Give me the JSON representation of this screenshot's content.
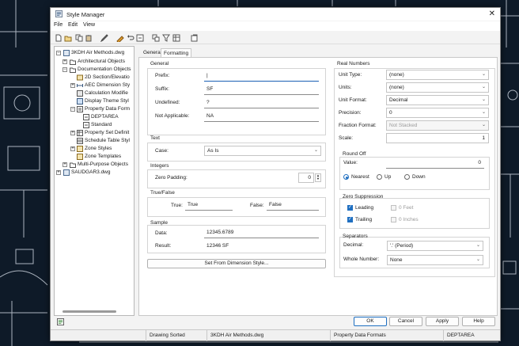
{
  "window": {
    "title": "Style Manager",
    "close_symbol": "✕"
  },
  "menu": [
    "File",
    "Edit",
    "View"
  ],
  "toolbar_icons": [
    "new-icon",
    "open-icon",
    "copy-icon",
    "paste-icon",
    "edit-style-icon",
    "purge-icon",
    "undo-icon",
    "refresh-icon",
    "toggle-view-icon",
    "filter-icon",
    "view-options-icon",
    "help-icon"
  ],
  "tree": {
    "root1": "3KDH Air Methods.dwg",
    "items": [
      "Architectural Objects",
      "Documentation Objects",
      "2D Section/Elevatio",
      "AEC Dimension Sty",
      "Calculation Modifie",
      "Display Theme Styl",
      "Property Data Form",
      "DEPTAREA",
      "Standard",
      "Property Set Definit",
      "Schedule Table Styl",
      "Zone Styles",
      "Zone Templates",
      "Multi-Purpose Objects"
    ],
    "root2": "SAUDGAR3.dwg",
    "tog_plus": "+",
    "tog_minus": "−"
  },
  "tabs": {
    "general": "General",
    "formatting": "Formatting"
  },
  "general": {
    "title": "General",
    "prefix_label": "Prefix:",
    "prefix_value": "|",
    "suffix_label": "Suffix:",
    "suffix_value": "SF",
    "undefined_label": "Undefined:",
    "undefined_value": "?",
    "not_applicable_label": "Not Applicable:",
    "not_applicable_value": "NA"
  },
  "text": {
    "title": "Text",
    "case_label": "Case:",
    "case_value": "As Is"
  },
  "integers": {
    "title": "Integers",
    "zero_padding_label": "Zero Padding:",
    "zero_padding_value": "0"
  },
  "truefalse": {
    "title": "True/False",
    "true_label": "True:",
    "true_value": "True",
    "false_label": "False:",
    "false_value": "False"
  },
  "sample": {
    "title": "Sample",
    "data_label": "Data:",
    "data_value": "12345.6789",
    "result_label": "Result:",
    "result_value": "12346 SF"
  },
  "set_from_dimension_label": "Set From Dimension Style...",
  "real_numbers": {
    "title": "Real Numbers",
    "unit_type_label": "Unit Type:",
    "unit_type_value": "(none)",
    "units_label": "Units:",
    "units_value": "(none)",
    "unit_format_label": "Unit Format:",
    "unit_format_value": "Decimal",
    "precision_label": "Precision:",
    "precision_value": "0",
    "fraction_format_label": "Fraction Format:",
    "fraction_format_value": "Not Stacked",
    "scale_label": "Scale:",
    "scale_value": "1"
  },
  "round_off": {
    "title": "Round Off",
    "value_label": "Value:",
    "value": "0",
    "nearest_label": "Nearest",
    "up_label": "Up",
    "down_label": "Down"
  },
  "zero_suppression": {
    "title": "Zero Suppression",
    "leading_label": "Leading",
    "trailing_label": "Trailing",
    "feet_label": "0 Feet",
    "inches_label": "0 Inches"
  },
  "separators": {
    "title": "Separators",
    "decimal_label": "Decimal:",
    "decimal_value": "'.' (Period)",
    "whole_label": "Whole Number:",
    "whole_value": "None"
  },
  "buttons": {
    "ok": "OK",
    "cancel": "Cancel",
    "apply": "Apply",
    "help": "Help"
  },
  "status": {
    "sort": "Drawing Sorted",
    "drawing": "3KDH Air Methods.dwg",
    "type": "Property Data Formats",
    "style": "DEPTAREA"
  },
  "chevron": "⌄",
  "spin_up": "▲",
  "spin_down": "▼",
  "colors": {
    "accent": "#1f6fc1",
    "bg_dark": "#0e1a28"
  }
}
